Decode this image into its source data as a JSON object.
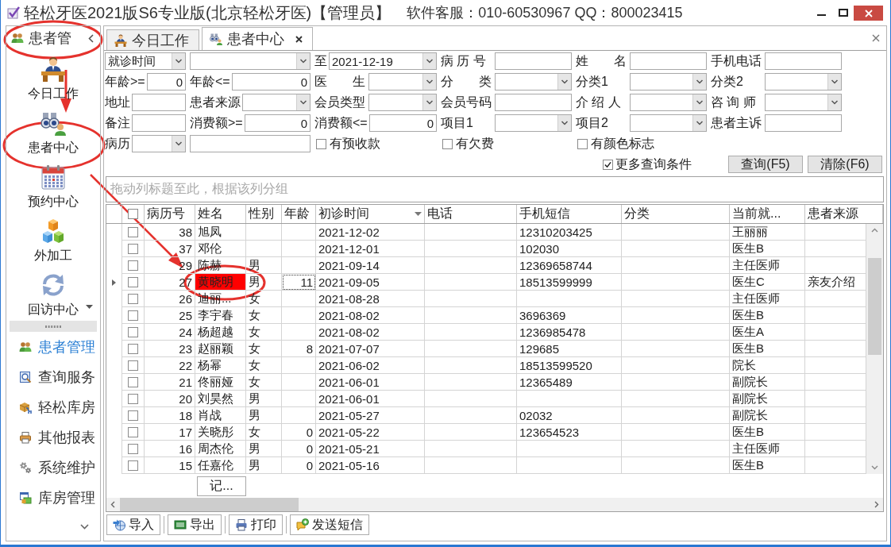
{
  "window": {
    "title": "轻松牙医2021版S6专业版(北京轻松牙医)【管理员】",
    "support": "软件客服：010-60530967 QQ：800023415"
  },
  "sidebar": {
    "header": "患者管",
    "large_items": [
      "今日工作",
      "患者中心",
      "预约中心",
      "外加工",
      "回访中心"
    ],
    "list_items": [
      {
        "label": "患者管理",
        "selected": true
      },
      {
        "label": "查询服务",
        "selected": false
      },
      {
        "label": "轻松库房",
        "selected": false
      },
      {
        "label": "其他报表",
        "selected": false
      },
      {
        "label": "系统维护",
        "selected": false
      },
      {
        "label": "库房管理",
        "selected": false
      }
    ]
  },
  "tabs": [
    {
      "label": "今日工作",
      "selected": false,
      "closable": false
    },
    {
      "label": "患者中心",
      "selected": true,
      "closable": true
    }
  ],
  "filters": {
    "rows": [
      [
        {
          "kind": "combo",
          "value": "就诊时间"
        },
        {
          "kind": "combo"
        },
        {
          "kind": "date",
          "label": "至",
          "value": "2021-12-19"
        },
        {
          "kind": "input",
          "label": "病 历 号"
        },
        {
          "kind": "input",
          "label": "姓　　名"
        },
        {
          "kind": "input",
          "label": "手机电话"
        }
      ],
      [
        {
          "kind": "number",
          "label": "年龄>=",
          "value": "0"
        },
        {
          "kind": "number",
          "label": "年龄<=",
          "value": "0"
        },
        {
          "kind": "combo",
          "label": "医　　生"
        },
        {
          "kind": "combo",
          "label": "分　　类"
        },
        {
          "kind": "combo",
          "label": "分类1"
        },
        {
          "kind": "combo",
          "label": "分类2"
        }
      ],
      [
        {
          "kind": "input",
          "label": "地址"
        },
        {
          "kind": "combo",
          "label": "患者来源"
        },
        {
          "kind": "combo",
          "label": "会员类型"
        },
        {
          "kind": "input",
          "label": "会员号码"
        },
        {
          "kind": "combo",
          "label": "介 绍 人"
        },
        {
          "kind": "combo",
          "label": "咨 询 师"
        }
      ],
      [
        {
          "kind": "input",
          "label": "备注"
        },
        {
          "kind": "number",
          "label": "消费额>=",
          "value": "0"
        },
        {
          "kind": "number",
          "label": "消费额<=",
          "value": "0"
        },
        {
          "kind": "combo",
          "label": "项目1"
        },
        {
          "kind": "combo",
          "label": "项目2"
        },
        {
          "kind": "input",
          "label": "患者主诉"
        }
      ],
      [
        {
          "kind": "combo",
          "label": "病历"
        },
        {
          "kind": "input"
        },
        {
          "kind": "checkbox",
          "label": "有预收款",
          "checked": false
        },
        {
          "kind": "checkbox",
          "label": "有欠费",
          "checked": false
        },
        {
          "kind": "checkbox",
          "label": "有颜色标志",
          "checked": false
        }
      ]
    ],
    "more": {
      "label": "更多查询条件",
      "checked": true
    },
    "buttons": [
      "查询(F5)",
      "清除(F6)"
    ]
  },
  "group_panel": {
    "hint": "拖动列标题至此，根据该列分组"
  },
  "table": {
    "all_checked": false,
    "columns": [
      {
        "label": "病历号",
        "sorted": false
      },
      {
        "label": "姓名",
        "sorted": false
      },
      {
        "label": "性别",
        "sorted": false
      },
      {
        "label": "年龄",
        "sorted": false
      },
      {
        "label": "初诊时间",
        "sorted": true
      },
      {
        "label": "电话",
        "sorted": false
      },
      {
        "label": "手机短信",
        "sorted": false
      },
      {
        "label": "分类",
        "sorted": false
      },
      {
        "label": "当前就...",
        "sorted": false
      },
      {
        "label": "患者来源",
        "sorted": false
      }
    ],
    "rows": [
      {
        "selected": false,
        "checked": false,
        "record_no": "38",
        "name": "旭凤",
        "first_visit": "2021-12-02",
        "mobile": "12310203425",
        "doctor": "王丽丽"
      },
      {
        "selected": false,
        "checked": false,
        "record_no": "37",
        "name": "邓伦",
        "first_visit": "2021-12-01",
        "mobile": "102030",
        "doctor": "医生B"
      },
      {
        "selected": false,
        "checked": false,
        "record_no": "29",
        "name": "陈赫",
        "sex": "男",
        "first_visit": "2021-09-14",
        "mobile": "12369658744",
        "doctor": "主任医师"
      },
      {
        "selected": true,
        "checked": false,
        "color": "#ff0000",
        "record_no": "27",
        "name": "黄晓明",
        "sex": "男",
        "age": "11",
        "first_visit": "2021-09-05",
        "mobile": "18513599999",
        "doctor": "医生C",
        "source": "亲友介绍"
      },
      {
        "selected": false,
        "checked": false,
        "record_no": "26",
        "name": "迪丽...",
        "sex": "女",
        "first_visit": "2021-08-28",
        "doctor": "主任医师"
      },
      {
        "selected": false,
        "checked": false,
        "record_no": "25",
        "name": "李宇春",
        "sex": "女",
        "first_visit": "2021-08-02",
        "mobile": "3696369",
        "doctor": "医生B"
      },
      {
        "selected": false,
        "checked": false,
        "record_no": "24",
        "name": "杨超越",
        "sex": "女",
        "first_visit": "2021-08-02",
        "mobile": "1236985478",
        "doctor": "医生A"
      },
      {
        "selected": false,
        "checked": false,
        "record_no": "23",
        "name": "赵丽颖",
        "sex": "女",
        "age": "8",
        "first_visit": "2021-07-07",
        "mobile": "129685",
        "doctor": "医生B"
      },
      {
        "selected": false,
        "checked": false,
        "record_no": "22",
        "name": "杨幂",
        "sex": "女",
        "first_visit": "2021-06-02",
        "mobile": "18513599520",
        "doctor": "院长"
      },
      {
        "selected": false,
        "checked": false,
        "record_no": "21",
        "name": "佟丽娅",
        "sex": "女",
        "first_visit": "2021-06-01",
        "mobile": "12365489",
        "doctor": "副院长"
      },
      {
        "selected": false,
        "checked": false,
        "record_no": "20",
        "name": "刘昊然",
        "sex": "男",
        "first_visit": "2021-06-01",
        "doctor": "副院长"
      },
      {
        "selected": false,
        "checked": false,
        "record_no": "18",
        "name": "肖战",
        "sex": "男",
        "first_visit": "2021-05-27",
        "mobile": "02032",
        "doctor": "副院长"
      },
      {
        "selected": false,
        "checked": false,
        "record_no": "17",
        "name": "关晓彤",
        "sex": "女",
        "age": "0",
        "first_visit": "2021-05-22",
        "mobile": "123654523",
        "doctor": "医生B"
      },
      {
        "selected": false,
        "checked": false,
        "record_no": "16",
        "name": "周杰伦",
        "sex": "男",
        "age": "0",
        "first_visit": "2021-05-21",
        "doctor": "主任医师"
      },
      {
        "selected": false,
        "checked": false,
        "record_no": "15",
        "name": "任嘉伦",
        "sex": "男",
        "age": "0",
        "first_visit": "2021-05-16",
        "doctor": "医生B"
      }
    ],
    "footer": "记..."
  },
  "toolbar": [
    "导入",
    "导出",
    "打印",
    "发送短信"
  ]
}
